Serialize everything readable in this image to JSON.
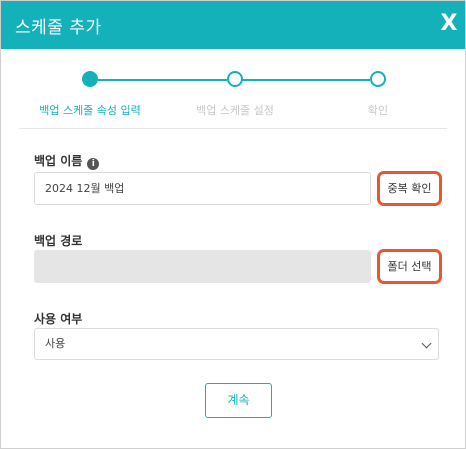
{
  "header": {
    "title": "스케줄 추가",
    "close_label": "X"
  },
  "stepper": {
    "steps": [
      {
        "label": "백업 스케줄 속성 입력",
        "state": "active"
      },
      {
        "label": "백업 스케줄 설정",
        "state": "inactive"
      },
      {
        "label": "확인",
        "state": "inactive"
      }
    ],
    "accent_color": "#14b1bb"
  },
  "form": {
    "backup_name": {
      "label": "백업 이름",
      "value": "2024 12월 백업",
      "info_icon": "info-icon",
      "action_label": "중복 확인"
    },
    "backup_path": {
      "label": "백업 경로",
      "value": "",
      "action_label": "폴더 선택"
    },
    "usage": {
      "label": "사용 여부",
      "selected": "사용"
    }
  },
  "footer": {
    "next_label": "계속"
  },
  "colors": {
    "header_bg": "#14b1bb",
    "highlight_border": "#e8572e"
  }
}
